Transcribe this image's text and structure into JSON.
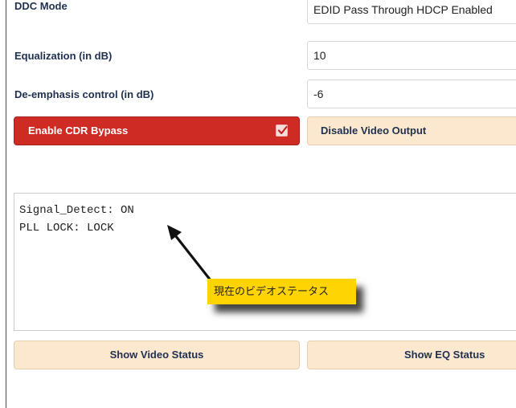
{
  "settings": {
    "ddc_mode": {
      "label": "DDC Mode",
      "value": "EDID Pass Through HDCP Enabled"
    },
    "equalization": {
      "label": "Equalization (in dB)",
      "value": "10"
    },
    "deemphasis": {
      "label": "De-emphasis control (in dB)",
      "value": "-6"
    }
  },
  "buttons": {
    "cdr_bypass": {
      "label": "Enable CDR Bypass",
      "checked": true
    },
    "video_output": {
      "label": "Disable Video Output"
    },
    "show_video_status": {
      "label": "Show Video Status"
    },
    "show_eq_status": {
      "label": "Show EQ Status"
    }
  },
  "status": {
    "line1": "Signal_Detect: ON",
    "line2": "PLL LOCK: LOCK"
  },
  "annotation": {
    "text": "現在のビデオステータス"
  },
  "colors": {
    "red_button": "#cf2b25",
    "peach_button": "#fce8cf",
    "callout": "#ffd400",
    "label_text": "#1f3050"
  }
}
